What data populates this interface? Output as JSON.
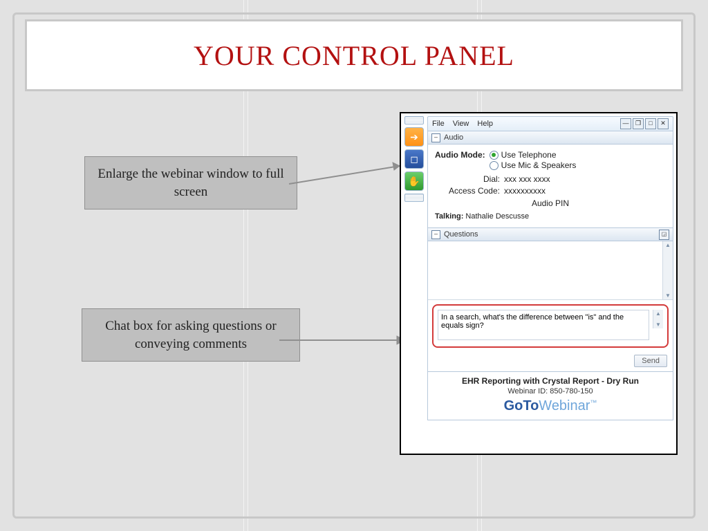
{
  "title": "YOUR CONTROL PANEL",
  "callouts": {
    "enlarge": "Enlarge the webinar window to full screen",
    "chatbox": "Chat box for asking questions or conveying comments"
  },
  "menu": {
    "file": "File",
    "view": "View",
    "help": "Help"
  },
  "sections": {
    "audio": "Audio",
    "questions": "Questions"
  },
  "audio": {
    "mode_label": "Audio Mode:",
    "opt_telephone": "Use Telephone",
    "opt_mic": "Use Mic & Speakers",
    "dial_label": "Dial:",
    "dial_value": "xxx xxx xxxx",
    "access_label": "Access Code:",
    "access_value": "xxxxxxxxxx",
    "pin_label": "Audio PIN",
    "talking_label": "Talking:",
    "talking_value": "Nathalie Descusse"
  },
  "questions": {
    "draft": "In a search, what's the difference between \"is\" and the equals sign?",
    "send": "Send"
  },
  "footer": {
    "session": "EHR Reporting with Crystal Report - Dry Run",
    "webinar_id_label": "Webinar ID:",
    "webinar_id": "850-780-150",
    "brand_go": "Go",
    "brand_to": "To",
    "brand_web": "Webinar",
    "brand_tm": "™"
  }
}
